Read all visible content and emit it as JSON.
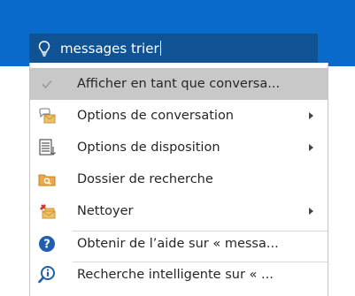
{
  "search": {
    "query": "messages trier"
  },
  "menu": {
    "items": [
      {
        "label": "Afficher en tant que conversa...",
        "icon": "checkmark-icon",
        "checked": true,
        "submenu": false
      },
      {
        "label": "Options de conversation",
        "icon": "conversation-options-icon",
        "submenu": true
      },
      {
        "label": "Options de disposition",
        "icon": "layout-options-icon",
        "submenu": true
      },
      {
        "label": "Dossier de recherche",
        "icon": "search-folder-icon",
        "submenu": false
      },
      {
        "label": "Nettoyer",
        "icon": "cleanup-icon",
        "submenu": true
      },
      {
        "label": "Obtenir de l’aide sur « messa...",
        "icon": "help-icon",
        "submenu": false
      },
      {
        "label": "Recherche intelligente sur « ...",
        "icon": "smart-lookup-icon",
        "submenu": false
      }
    ]
  },
  "colors": {
    "ribbon_blue": "#0a6ac9",
    "search_box": "#0f5394",
    "highlight": "#c8c8c8",
    "help_blue": "#1f5fad"
  }
}
